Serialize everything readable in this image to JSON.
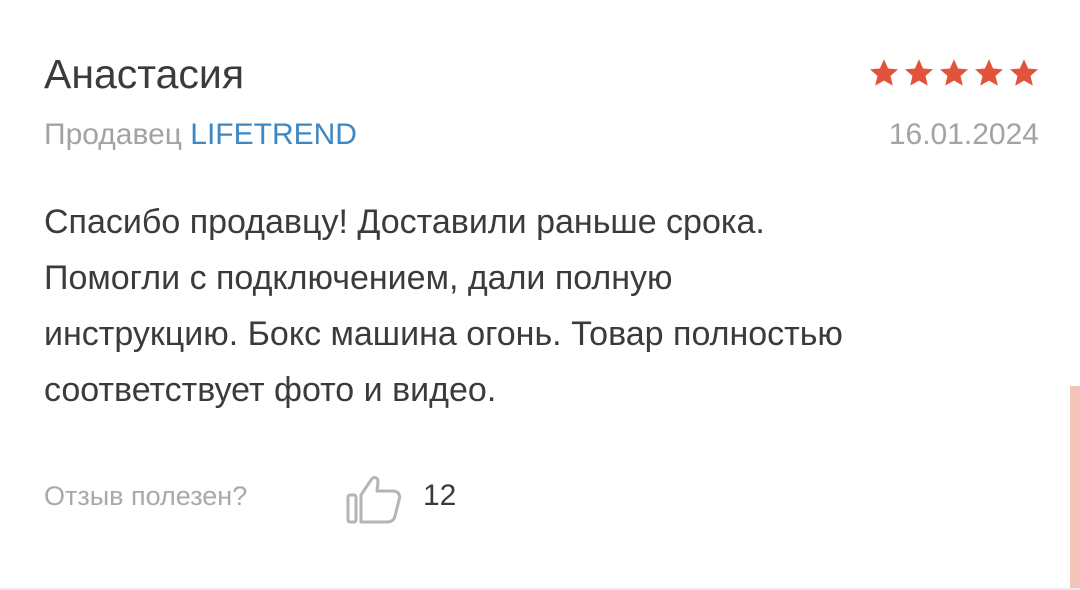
{
  "review": {
    "author": "Анастасия",
    "rating": 5,
    "rating_max": 5,
    "star_color": "#e2533b",
    "seller_prefix": "Продавец",
    "seller_name": "LIFETREND",
    "seller_link_color": "#3d87c2",
    "date": "16.01.2024",
    "text_lines": [
      "Спасибо продавцу! Доставили раньше срока.",
      "Помогли с подключением, дали полную",
      "инструкцию. Бокс машина огонь. Товар полностью",
      "соответствует фото и видео."
    ],
    "helpful_label": "Отзыв полезен?",
    "like_icon": "thumbs-up-icon",
    "like_count": "12"
  }
}
